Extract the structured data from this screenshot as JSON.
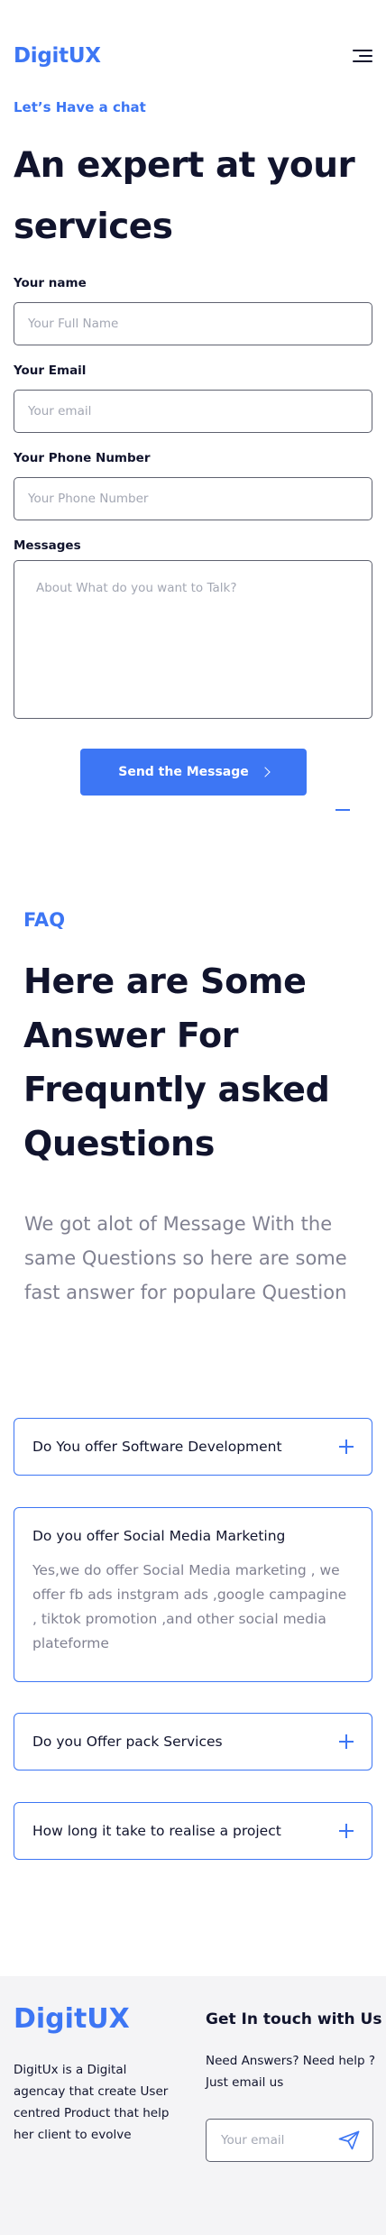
{
  "header": {
    "logo": "DigitUX",
    "menu_icon": "hamburger-menu-icon"
  },
  "contact": {
    "eyebrow": "Let’s Have a chat",
    "title": "An expert at your services",
    "fields": {
      "name": {
        "label": "Your name",
        "placeholder": "Your Full Name"
      },
      "email": {
        "label": "Your Email",
        "placeholder": "Your email"
      },
      "phone": {
        "label": "Your Phone Number",
        "placeholder": "Your Phone Number"
      },
      "message": {
        "label": "Messages",
        "placeholder": "About What do you want to Talk?"
      }
    },
    "send_label": "Send the Message",
    "send_icon": "chevron-right-icon"
  },
  "faq": {
    "eyebrow": "FAQ",
    "title": "Here are Some Answer For Frequntly asked Questions",
    "subtitle": "We got alot of Message With the same Questions so here are some fast answer for populare Question",
    "items": [
      {
        "question": "Do You offer Software Development",
        "answer": "",
        "expanded": false
      },
      {
        "question": "Do you offer Social Media Marketing",
        "answer": "Yes,we do offer Social Media marketing , we offer fb ads instgram ads ,google campagine , tiktok promotion ,and other social media plateforme",
        "expanded": true
      },
      {
        "question": "Do you Offer pack Services",
        "answer": "",
        "expanded": false
      },
      {
        "question": "How long it take to realise a project",
        "answer": "",
        "expanded": false
      }
    ]
  },
  "footer": {
    "logo": "DigitUX",
    "description": "DigitUx is a Digital agencay that create User centred Product that help her client to evolve",
    "contact_heading": "Get In touch with Us",
    "contact_text": "Need Answers? Need help ? Just email us",
    "email_placeholder": "Your email",
    "send_icon": "paper-plane-icon"
  },
  "colors": {
    "accent": "#3d76f4",
    "text": "#11142d",
    "muted": "#808191",
    "footer_bg": "#f4f4f6"
  }
}
